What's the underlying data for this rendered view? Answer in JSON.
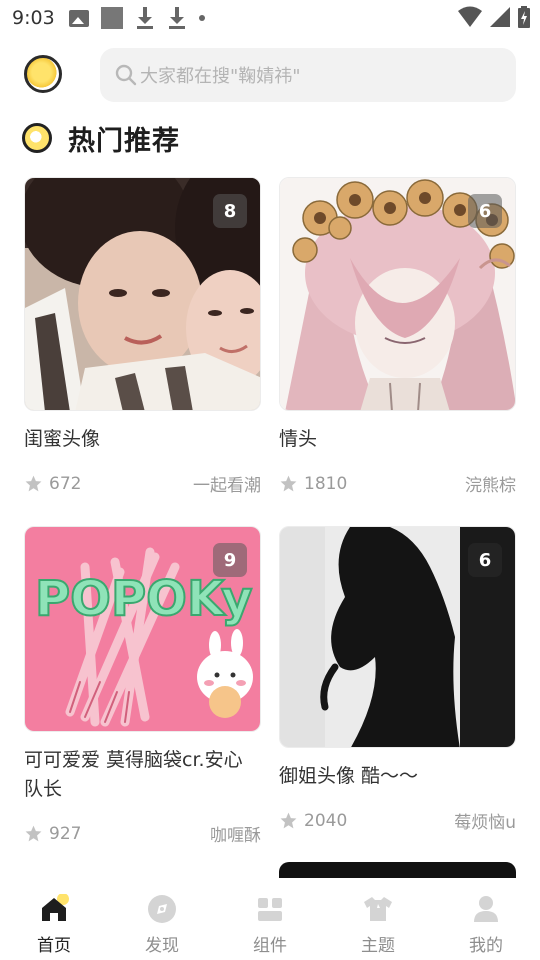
{
  "status": {
    "time": "9:03"
  },
  "search": {
    "placeholder": "大家都在搜\"鞠婧祎\""
  },
  "section": {
    "title": "热门推荐"
  },
  "cards": [
    {
      "count": "8",
      "title": "闺蜜头像",
      "stars": "672",
      "author": "一起看潮"
    },
    {
      "count": "6",
      "title": "情头",
      "stars": "1810",
      "author": "浣熊棕"
    },
    {
      "count": "9",
      "title": "可可爱爱 莫得脑袋cr.安心队长",
      "stars": "927",
      "author": "咖喱酥",
      "image_text": "POPOKy"
    },
    {
      "count": "6",
      "title": "御姐头像 酷～～",
      "stars": "2040",
      "author": "莓烦恼u"
    }
  ],
  "nav": [
    {
      "label": "首页",
      "icon": "home-icon",
      "active": true
    },
    {
      "label": "发现",
      "icon": "discover-icon"
    },
    {
      "label": "组件",
      "icon": "widgets-icon"
    },
    {
      "label": "主题",
      "icon": "theme-shirt-icon"
    },
    {
      "label": "我的",
      "icon": "profile-icon"
    }
  ],
  "colors": {
    "accent": "#ffe36b",
    "text": "#222222",
    "muted": "#9a9a9a",
    "search_bg": "#f2f2f2"
  }
}
